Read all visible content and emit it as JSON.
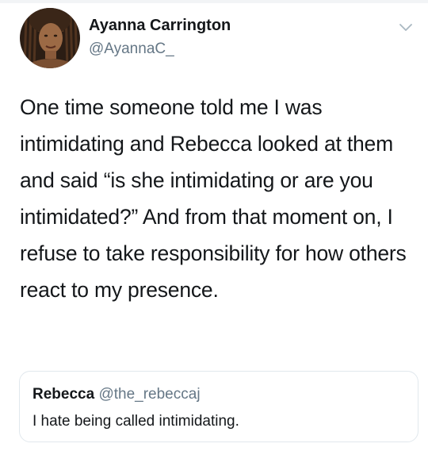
{
  "tweet": {
    "author": {
      "display_name": "Ayanna Carrington",
      "handle": "@AyannaC_"
    },
    "menu_icon": "chevron-down-icon",
    "text": "One time someone told me I was intimidating and Rebecca looked at them and said “is she intimidating or are you intimidated?” And from that moment on, I refuse to take responsibility for how others react to my presence.",
    "quoted": {
      "display_name": "Rebecca",
      "handle": "@the_rebeccaj",
      "text": "I hate being called intimidating."
    }
  },
  "colors": {
    "text_primary": "#14171a",
    "text_secondary": "#657786",
    "border": "#e1e8ed",
    "chevron": "#aab8c2"
  }
}
